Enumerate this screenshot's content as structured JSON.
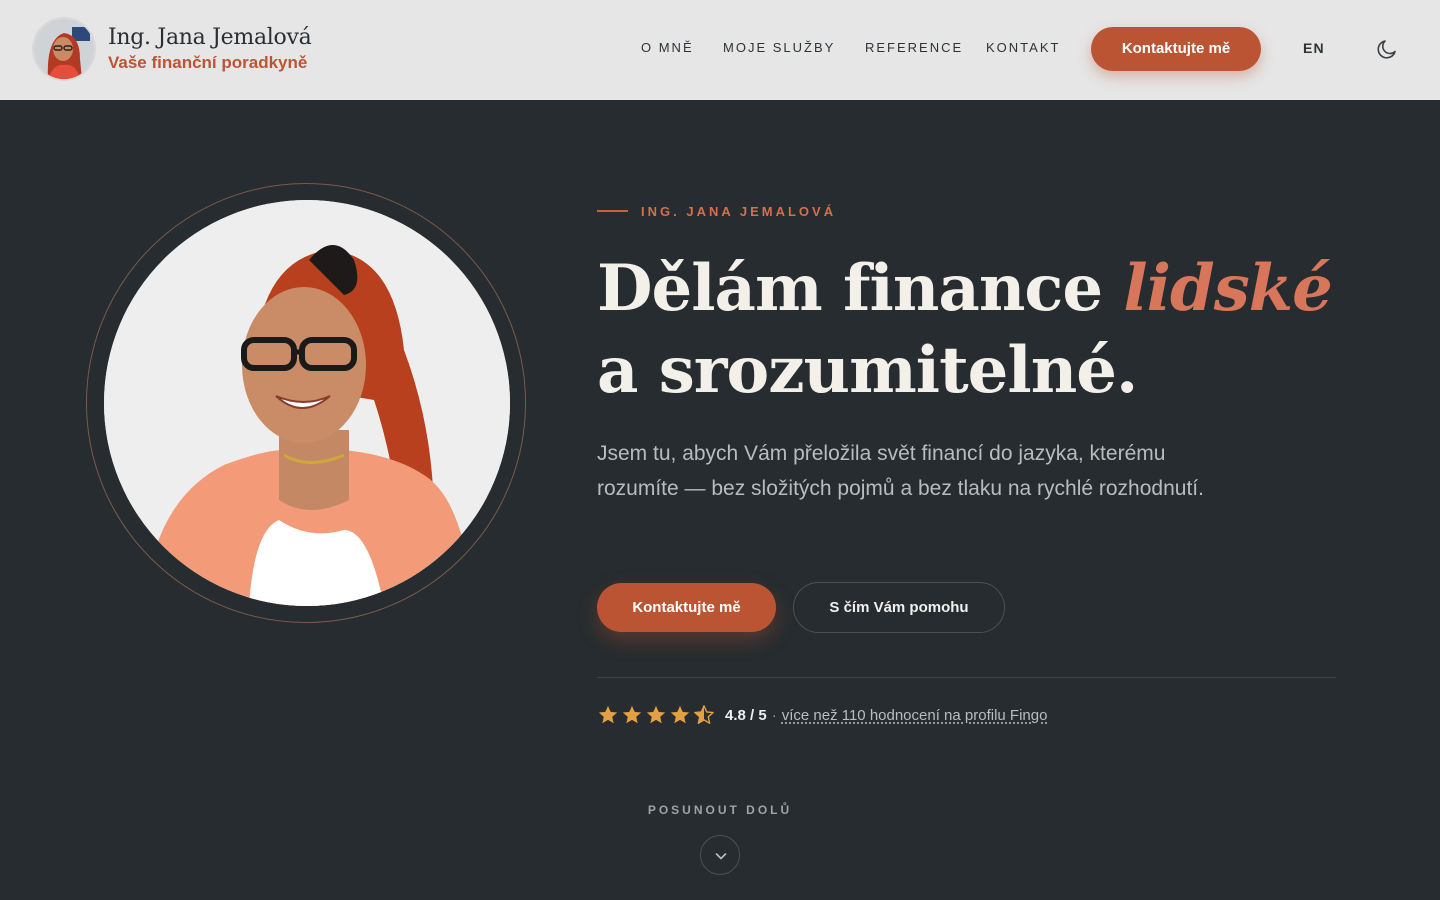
{
  "header": {
    "brand_name": "Ing. Jana Jemalová",
    "brand_subtitle": "Vaše finanční poradkyně",
    "nav": [
      "O MNĚ",
      "MOJE SLUŽBY",
      "REFERENCE",
      "KONTAKT"
    ],
    "cta_label": "Kontaktujte mě",
    "language": "EN",
    "theme_icon": "moon-icon"
  },
  "hero": {
    "eyebrow": "ING. JANA JEMALOVÁ",
    "headline_part1": "Dělám finance ",
    "headline_accent": "lidské",
    "headline_part2": "a srozumitelné.",
    "lead": "Jsem tu, abych Vám přeložila svět financí do jazyka, kterému rozumíte — bez složitých pojmů a bez tlaku na rychlé rozhodnutí.",
    "primary_button": "Kontaktujte mě",
    "secondary_button": "S čím Vám pomohu",
    "rating": {
      "stars": 4.5,
      "score": "4.8 / 5",
      "separator": "·",
      "link_text": "více než 110 hodnocení na profilu Fingo"
    },
    "scroll_label": "POSUNOUT DOLŮ"
  },
  "colors": {
    "accent": "#bb5433",
    "accent_light": "#d7765a",
    "star": "#e2a042",
    "background_dark": "#262c2f",
    "header_bg": "#e6e6e6"
  }
}
